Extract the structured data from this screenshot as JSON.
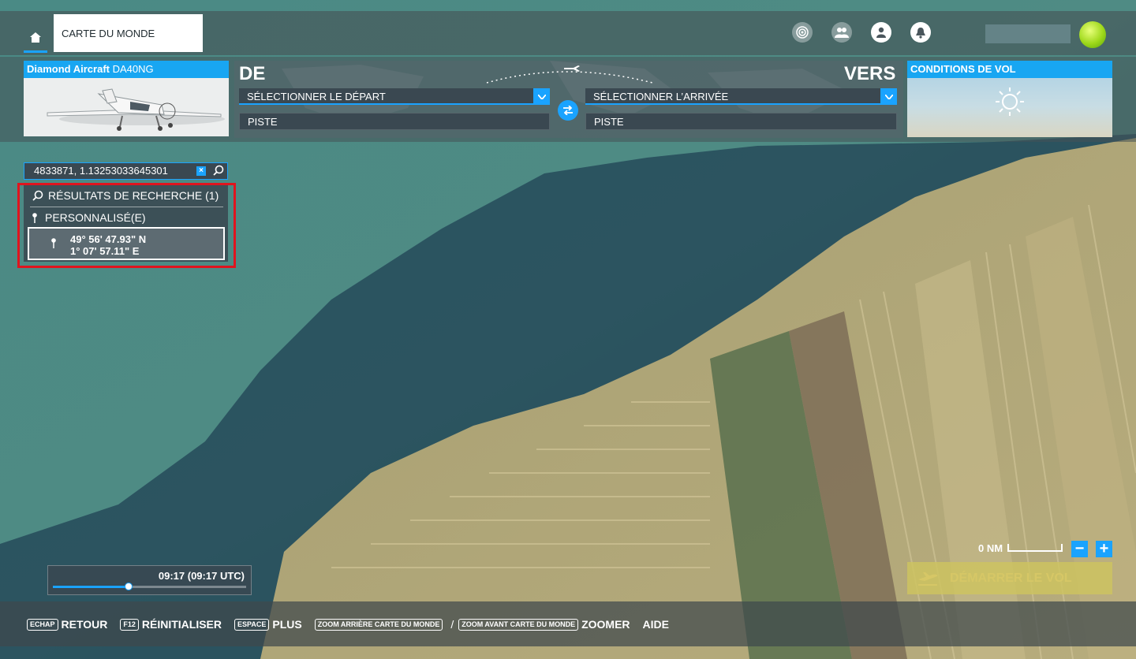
{
  "topbar": {
    "world_map_tab": "CARTE DU MONDE"
  },
  "aircraft": {
    "make": "Diamond Aircraft",
    "model": "DA40NG"
  },
  "route": {
    "from_label": "DE",
    "to_label": "VERS",
    "departure_select": "SÉLECTIONNER LE DÉPART",
    "arrival_select": "SÉLECTIONNER L’ARRIVÉE",
    "departure_runway": "PISTE",
    "arrival_runway": "PISTE"
  },
  "conditions": {
    "title": "CONDITIONS DE VOL"
  },
  "search": {
    "value": "4833871, 1.13253033645301"
  },
  "results": {
    "header": "RÉSULTATS DE RECHERCHE (1)",
    "category": "PERSONNALISÉ(E)",
    "item_lat": "49° 56' 47.93\" N",
    "item_lon": "1° 07' 57.11\" E"
  },
  "map": {
    "scale_label": "0 NM",
    "zoom_out": "−",
    "zoom_in": "+",
    "start_flight": "DÉMARRER LE VOL"
  },
  "time": {
    "label": "09:17 (09:17 UTC)",
    "progress": 0.39
  },
  "shortcuts": [
    {
      "key": "ECHAP",
      "label": "RETOUR"
    },
    {
      "key": "F12",
      "label": "RÉINITIALISER"
    },
    {
      "key": "ESPACE",
      "label": "PLUS"
    },
    {
      "key": "ZOOM ARRIÈRE CARTE DU MONDE",
      "sep": "/",
      "key2": "ZOOM AVANT CARTE DU MONDE",
      "label": "ZOOMER"
    },
    {
      "label": "AIDE"
    }
  ],
  "colors": {
    "accent": "#1aa3ff",
    "highlight": "#e0141e"
  }
}
